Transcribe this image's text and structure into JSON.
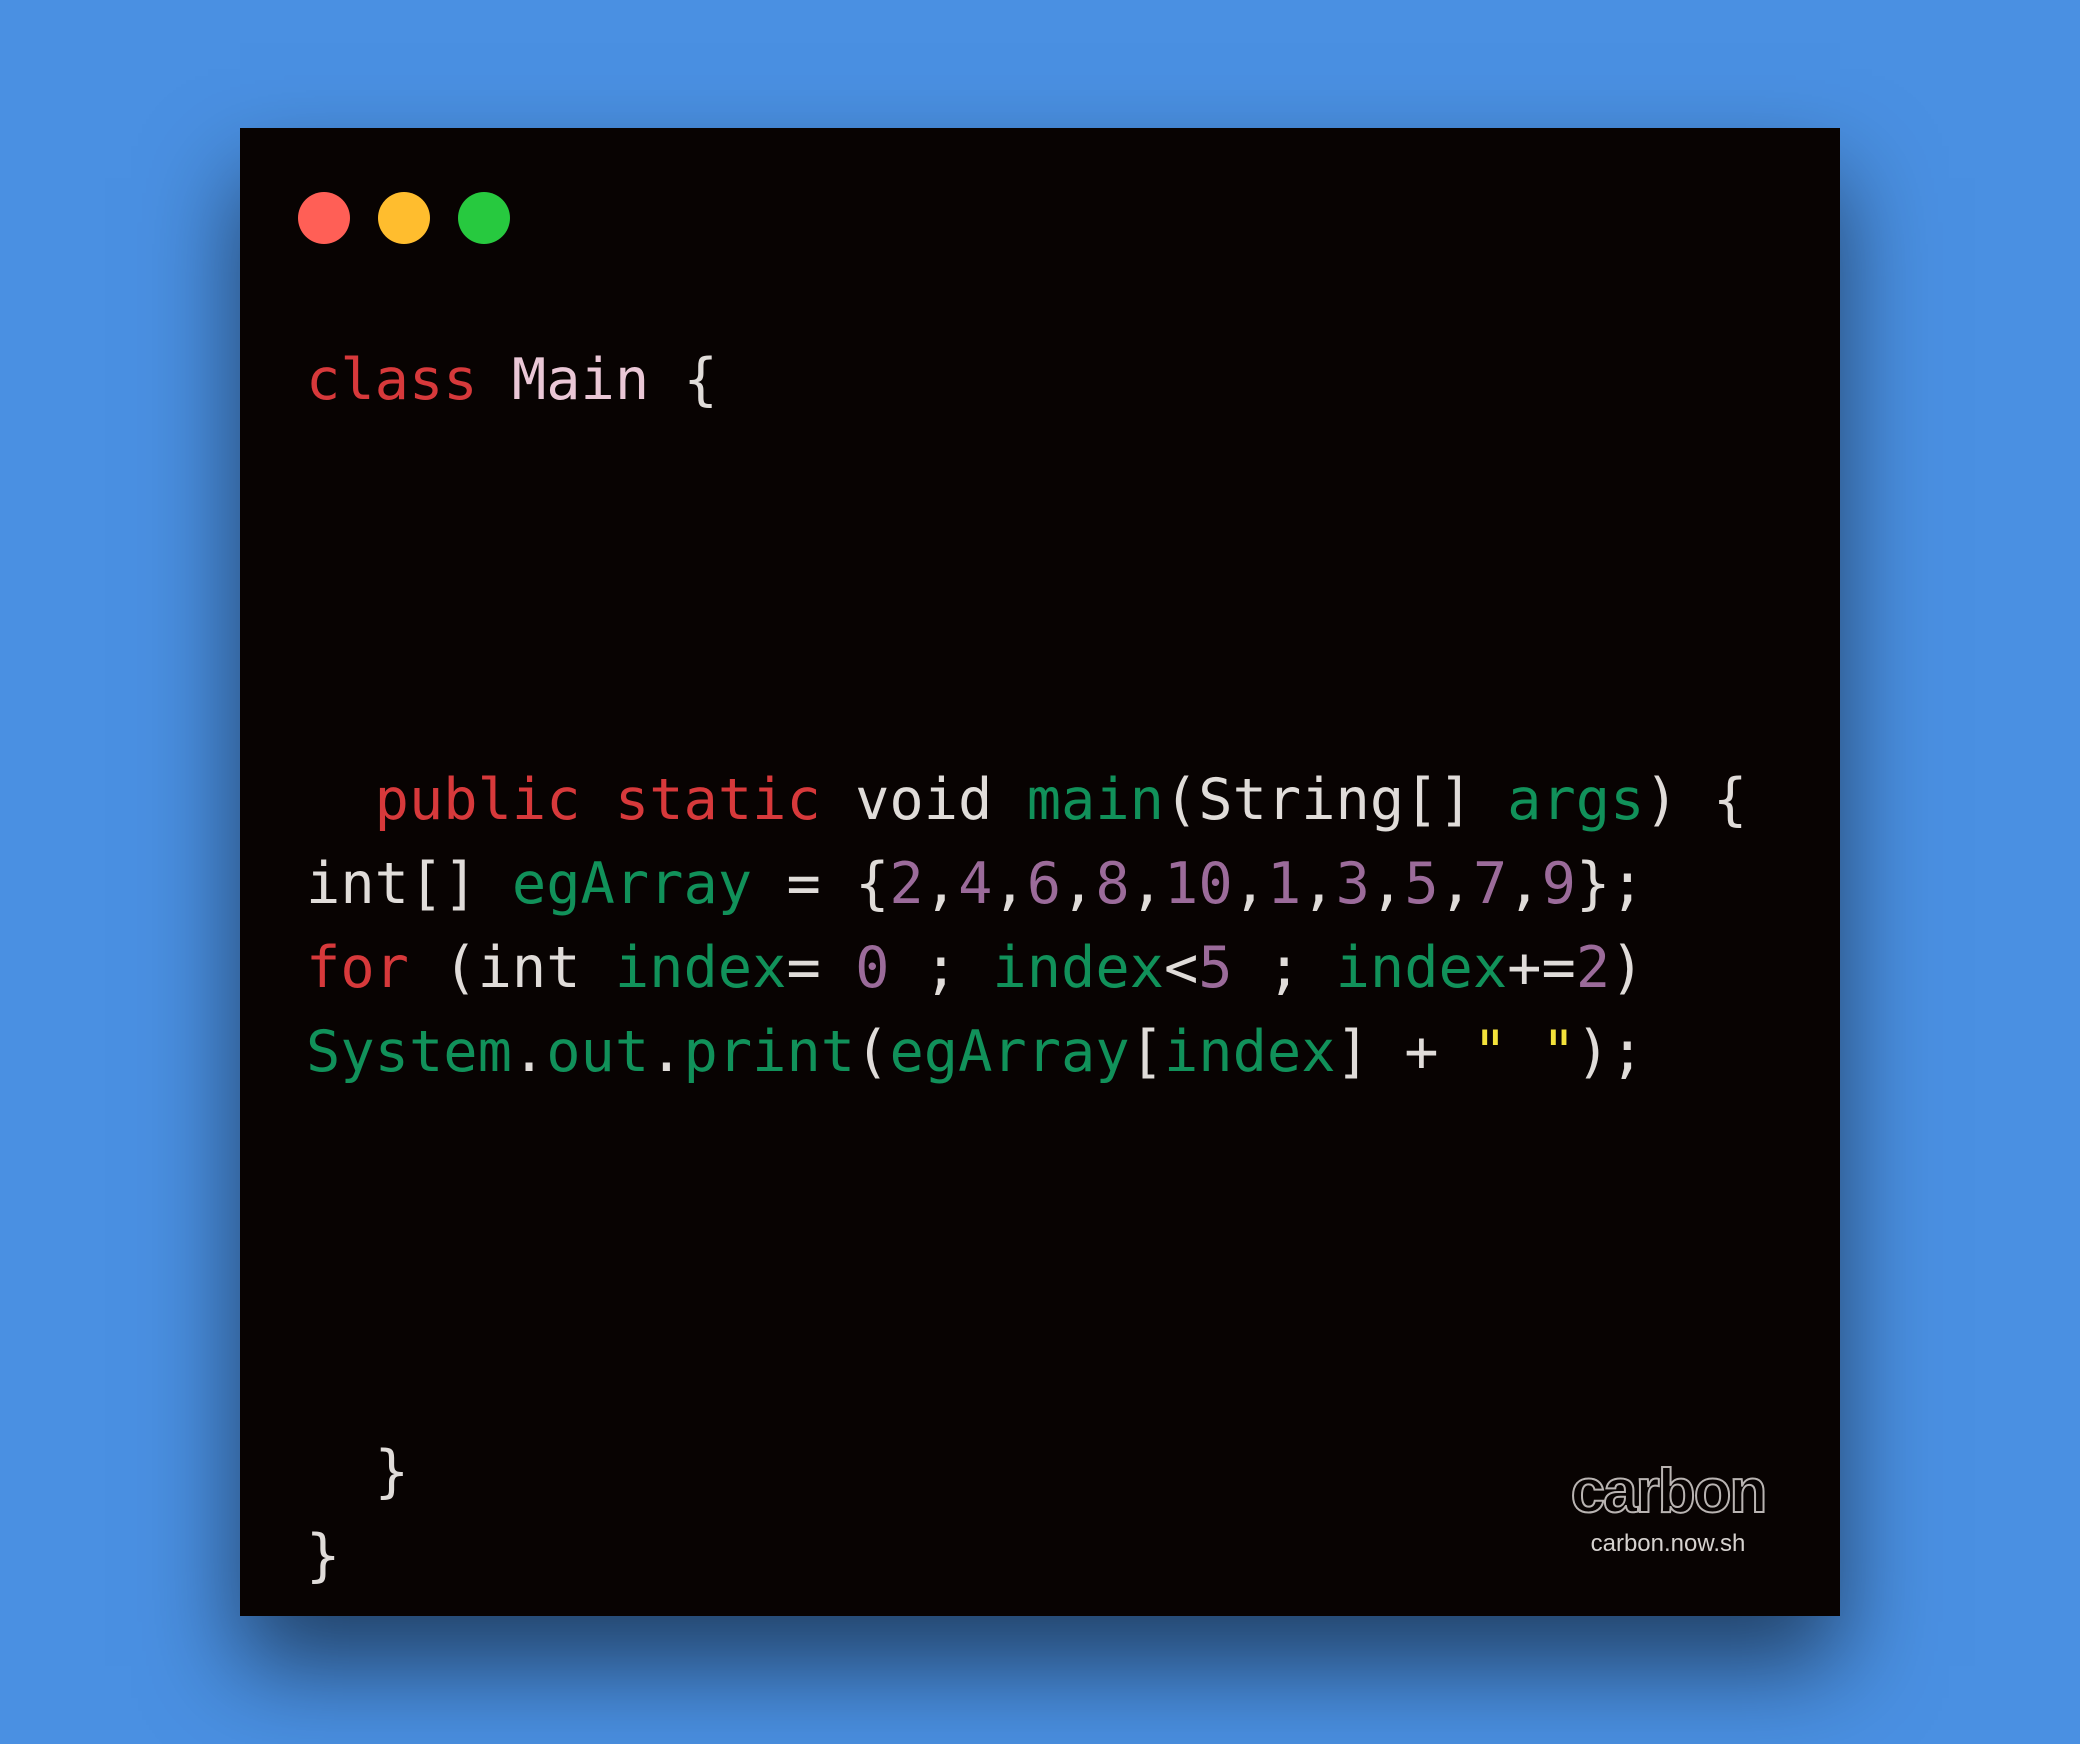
{
  "window": {
    "controls": [
      {
        "name": "close",
        "color": "#ff5f56"
      },
      {
        "name": "minimize",
        "color": "#ffbd2e"
      },
      {
        "name": "zoom",
        "color": "#27c93f"
      }
    ]
  },
  "code": {
    "lines": [
      [
        {
          "t": "class",
          "k": "kw"
        },
        {
          "t": " ",
          "k": "plain"
        },
        {
          "t": "Main",
          "k": "cls"
        },
        {
          "t": " {",
          "k": "plain"
        }
      ],
      [],
      [],
      [],
      [],
      [
        {
          "t": "  ",
          "k": "plain"
        },
        {
          "t": "public",
          "k": "kw"
        },
        {
          "t": " ",
          "k": "plain"
        },
        {
          "t": "static",
          "k": "kw"
        },
        {
          "t": " void ",
          "k": "plain"
        },
        {
          "t": "main",
          "k": "fn"
        },
        {
          "t": "(String[] ",
          "k": "plain"
        },
        {
          "t": "args",
          "k": "fn"
        },
        {
          "t": ") {",
          "k": "plain"
        }
      ],
      [
        {
          "t": "int[] ",
          "k": "plain"
        },
        {
          "t": "egArray",
          "k": "fn"
        },
        {
          "t": " = {",
          "k": "plain"
        },
        {
          "t": "2",
          "k": "num"
        },
        {
          "t": ",",
          "k": "plain"
        },
        {
          "t": "4",
          "k": "num"
        },
        {
          "t": ",",
          "k": "plain"
        },
        {
          "t": "6",
          "k": "num"
        },
        {
          "t": ",",
          "k": "plain"
        },
        {
          "t": "8",
          "k": "num"
        },
        {
          "t": ",",
          "k": "plain"
        },
        {
          "t": "10",
          "k": "num"
        },
        {
          "t": ",",
          "k": "plain"
        },
        {
          "t": "1",
          "k": "num"
        },
        {
          "t": ",",
          "k": "plain"
        },
        {
          "t": "3",
          "k": "num"
        },
        {
          "t": ",",
          "k": "plain"
        },
        {
          "t": "5",
          "k": "num"
        },
        {
          "t": ",",
          "k": "plain"
        },
        {
          "t": "7",
          "k": "num"
        },
        {
          "t": ",",
          "k": "plain"
        },
        {
          "t": "9",
          "k": "num"
        },
        {
          "t": "};",
          "k": "plain"
        }
      ],
      [
        {
          "t": "for",
          "k": "kw"
        },
        {
          "t": " (int ",
          "k": "plain"
        },
        {
          "t": "index",
          "k": "fn"
        },
        {
          "t": "= ",
          "k": "plain"
        },
        {
          "t": "0",
          "k": "num"
        },
        {
          "t": " ; ",
          "k": "plain"
        },
        {
          "t": "index",
          "k": "fn"
        },
        {
          "t": "<",
          "k": "plain"
        },
        {
          "t": "5",
          "k": "num"
        },
        {
          "t": " ; ",
          "k": "plain"
        },
        {
          "t": "index",
          "k": "fn"
        },
        {
          "t": "+=",
          "k": "plain"
        },
        {
          "t": "2",
          "k": "num"
        },
        {
          "t": ")",
          "k": "plain"
        }
      ],
      [
        {
          "t": "System",
          "k": "fn"
        },
        {
          "t": ".",
          "k": "plain"
        },
        {
          "t": "out",
          "k": "fn"
        },
        {
          "t": ".",
          "k": "plain"
        },
        {
          "t": "print",
          "k": "fn"
        },
        {
          "t": "(",
          "k": "plain"
        },
        {
          "t": "egArray",
          "k": "fn"
        },
        {
          "t": "[",
          "k": "plain"
        },
        {
          "t": "index",
          "k": "fn"
        },
        {
          "t": "] + ",
          "k": "plain"
        },
        {
          "t": "\" \"",
          "k": "str"
        },
        {
          "t": ");",
          "k": "plain"
        }
      ],
      [],
      [],
      [],
      [],
      [
        {
          "t": "  }",
          "k": "plain"
        }
      ],
      [
        {
          "t": "}",
          "k": "plain"
        }
      ]
    ]
  },
  "watermark": {
    "logo": "carbon",
    "url": "carbon.now.sh"
  }
}
